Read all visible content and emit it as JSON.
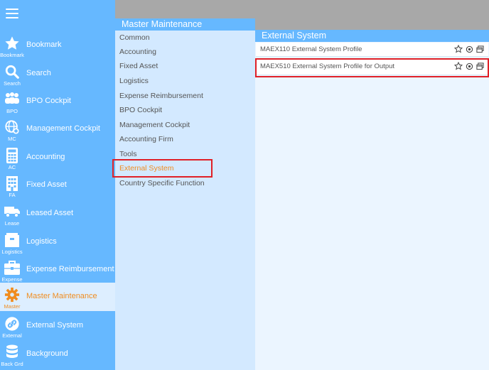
{
  "sidebar": {
    "items": [
      {
        "label": "Bookmark",
        "sub": "Bookmark",
        "icon": "star-icon"
      },
      {
        "label": "Search",
        "sub": "Search",
        "icon": "search-icon"
      },
      {
        "label": "BPO Cockpit",
        "sub": "BPO",
        "icon": "people-icon"
      },
      {
        "label": "Management Cockpit",
        "sub": "MC",
        "icon": "globe-icon"
      },
      {
        "label": "Accounting",
        "sub": "AC",
        "icon": "calculator-icon"
      },
      {
        "label": "Fixed Asset",
        "sub": "FA",
        "icon": "building-icon"
      },
      {
        "label": "Leased Asset",
        "sub": "Lease",
        "icon": "truck-icon"
      },
      {
        "label": "Logistics",
        "sub": "Logistics",
        "icon": "box-icon"
      },
      {
        "label": "Expense Reimbursement",
        "sub": "Expense",
        "icon": "briefcase-icon"
      },
      {
        "label": "Master Maintenance",
        "sub": "Master",
        "icon": "gear-icon"
      },
      {
        "label": "External System",
        "sub": "External",
        "icon": "link-icon"
      },
      {
        "label": "Background",
        "sub": "Back Grd",
        "icon": "database-icon"
      }
    ]
  },
  "master": {
    "title": "Master Maintenance",
    "items": [
      "Common",
      "Accounting",
      "Fixed Asset",
      "Logistics",
      "Expense Reimbursement",
      "BPO Cockpit",
      "Management Cockpit",
      "Accounting Firm",
      "Tools",
      "External System",
      "Country Specific Function"
    ]
  },
  "external": {
    "title": "External System",
    "rows": [
      "MAEX110 External System Profile",
      "MAEX510 External System Profile for Output"
    ]
  },
  "colors": {
    "sidebar": "#66b8ff",
    "active": "#f08c1e",
    "highlight": "#e02027"
  }
}
